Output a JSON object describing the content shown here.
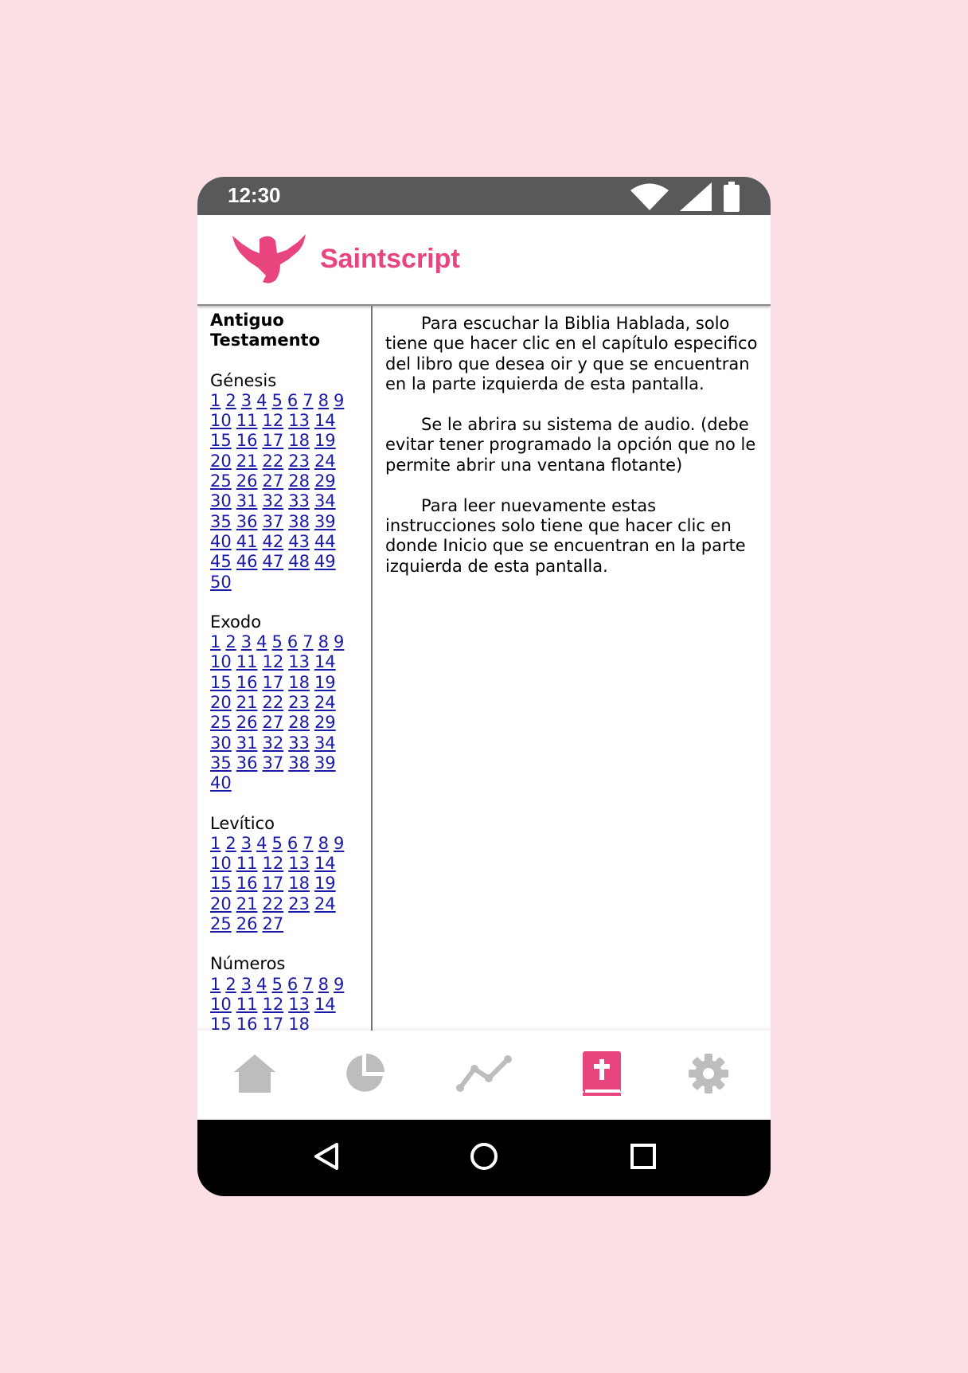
{
  "status_bar": {
    "time": "12:30",
    "icons": [
      "wifi-icon",
      "signal-icon",
      "battery-icon"
    ]
  },
  "header": {
    "app_title": "Saintscript",
    "logo": "dove-logo",
    "accent": "#e8457e"
  },
  "sidebar": {
    "testament": "Antiguo Testamento",
    "books": [
      {
        "name": "Génesis",
        "chapters": 50
      },
      {
        "name": "Exodo",
        "chapters": 40
      },
      {
        "name": "Levítico",
        "chapters": 27
      },
      {
        "name": "Números",
        "chapters": 18
      }
    ]
  },
  "instructions": {
    "paragraphs": [
      "Para escuchar la Biblia Hablada, solo tiene que hacer clic en el capítulo especifico del libro que desea oir y que se encuentran en la parte izquierda de esta pantalla.",
      "Se le abrira su sistema de audio. (debe evitar tener programado la opción que no le permite abrir una ventana flotante)",
      "Para leer nuevamente estas instrucciones solo tiene que hacer clic en donde Inicio que se encuentran en la parte izquierda de esta pantalla."
    ]
  },
  "bottom_nav": {
    "items": [
      {
        "icon": "home-icon",
        "active": false
      },
      {
        "icon": "pie-chart-icon",
        "active": false
      },
      {
        "icon": "line-chart-icon",
        "active": false
      },
      {
        "icon": "bible-icon",
        "active": true
      },
      {
        "icon": "gear-icon",
        "active": false
      }
    ],
    "active_color": "#e8457e",
    "inactive_color": "#bdbdbd"
  },
  "system_nav": {
    "buttons": [
      "back-icon",
      "home-circle-icon",
      "recents-icon"
    ]
  }
}
